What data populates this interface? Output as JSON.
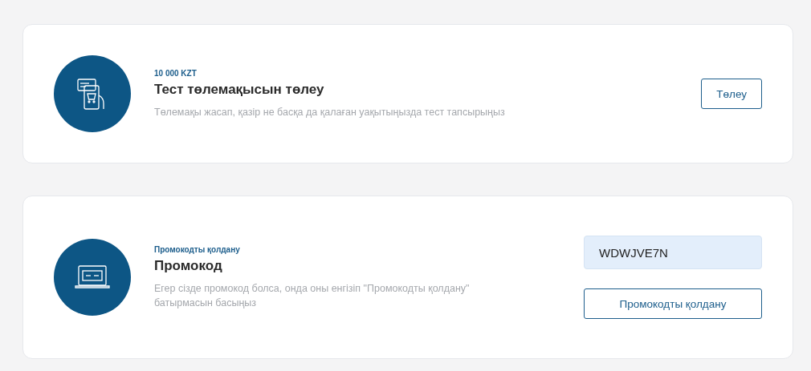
{
  "cards": [
    {
      "kind": "payment",
      "eyebrow": "10 000 KZT",
      "title": "Тест төлемақысын төлеу",
      "description": "Төлемақы жасап, қазір не басқа да қалаған уақытыңызда тест тапсырыңыз",
      "button": "Төлеу"
    },
    {
      "kind": "promo",
      "eyebrow": "Промокодты қолдану",
      "title": "Промокод",
      "description": "Егер сізде промокод болса, онда оны енгізіп \"Промокодты қолдану\" батырмасын басыңыз",
      "field_value": "WDWJVE7N",
      "button": "Промокодты қолдану"
    }
  ]
}
